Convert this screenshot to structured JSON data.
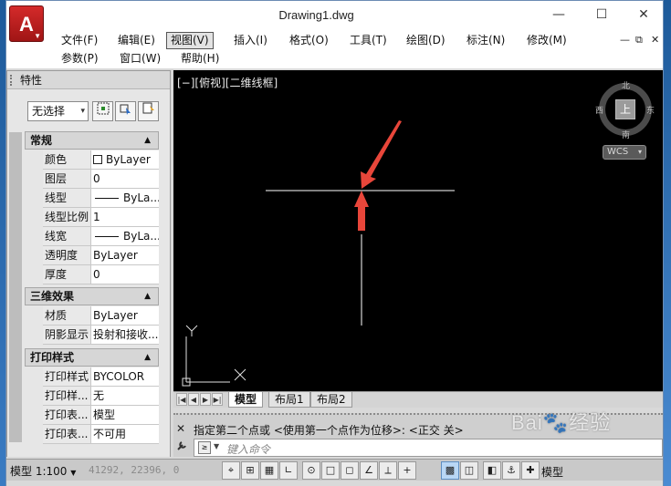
{
  "window": {
    "title": "Drawing1.dwg",
    "minimize_glyph": "—",
    "maximize_glyph": "☐",
    "close_glyph": "✕"
  },
  "app_logo": {
    "letter": "A",
    "dropdown_glyph": "▼"
  },
  "menus": {
    "row1": [
      "文件(F)",
      "编辑(E)",
      "视图(V)",
      "插入(I)",
      "格式(O)",
      "工具(T)",
      "绘图(D)",
      "标注(N)",
      "修改(M)"
    ],
    "row2": [
      "参数(P)",
      "窗口(W)",
      "帮助(H)"
    ],
    "active": "视图(V)",
    "mdi_controls": [
      "—",
      "⧉",
      "✕"
    ]
  },
  "properties_palette": {
    "title": "特性",
    "selection": "无选择",
    "selection_arrow": "▾",
    "sections": {
      "general": {
        "title": "常规",
        "toggle": "▲",
        "rows": [
          {
            "key": "颜色",
            "value": "ByLayer",
            "swatch": true
          },
          {
            "key": "图层",
            "value": "0"
          },
          {
            "key": "线型",
            "value": "ByLa...",
            "line": true
          },
          {
            "key": "线型比例",
            "value": "1"
          },
          {
            "key": "线宽",
            "value": "ByLa...",
            "line": true
          },
          {
            "key": "透明度",
            "value": "ByLayer"
          },
          {
            "key": "厚度",
            "value": "0"
          }
        ]
      },
      "3d": {
        "title": "三维效果",
        "toggle": "▲",
        "rows": [
          {
            "key": "材质",
            "value": "ByLayer"
          },
          {
            "key": "阴影显示",
            "value": "投射和接收..."
          }
        ]
      },
      "plot": {
        "title": "打印样式",
        "toggle": "▲",
        "rows": [
          {
            "key": "打印样式",
            "value": "BYCOLOR"
          },
          {
            "key": "打印样...",
            "value": "无"
          },
          {
            "key": "打印表...",
            "value": "模型"
          },
          {
            "key": "打印表...",
            "value": "不可用"
          }
        ]
      }
    }
  },
  "viewport": {
    "label": "[−][俯视][二维线框]",
    "viewcube": {
      "top": "上",
      "north": "北",
      "south": "南",
      "east": "东",
      "west": "西"
    },
    "wcs": "WCS",
    "wcs_arrow": "▾",
    "ucs": {
      "x": "X",
      "y": "Y"
    },
    "colors": {
      "background": "#000000",
      "lines": "#ffffff",
      "arrows": "#e8463a"
    }
  },
  "layout_tabs": {
    "nav": [
      "|◀",
      "◀",
      "▶",
      "▶|"
    ],
    "tabs": [
      "模型",
      "布局1",
      "布局2"
    ],
    "active": "模型"
  },
  "command_line": {
    "close_glyph": "✕",
    "wrench_glyph": "🔧",
    "history": "指定第二个点或 <使用第一个点作为位移>: <正交 关>",
    "prompt_glyph": "≥",
    "placeholder": "键入命令"
  },
  "status_bar": {
    "scale": "模型 1:100",
    "scale_arrow": "▼",
    "coords": "41292, 22396, 0",
    "model_label": "模型",
    "buttons": [
      "⌖",
      "⊞",
      "▦",
      "∟",
      "⊙",
      "□",
      "◻",
      "∠",
      "⟂",
      "+",
      "▩",
      "◫",
      "◧",
      "⚓",
      "✚"
    ]
  },
  "watermark": {
    "brand": "Bai",
    "tail": "经验"
  }
}
